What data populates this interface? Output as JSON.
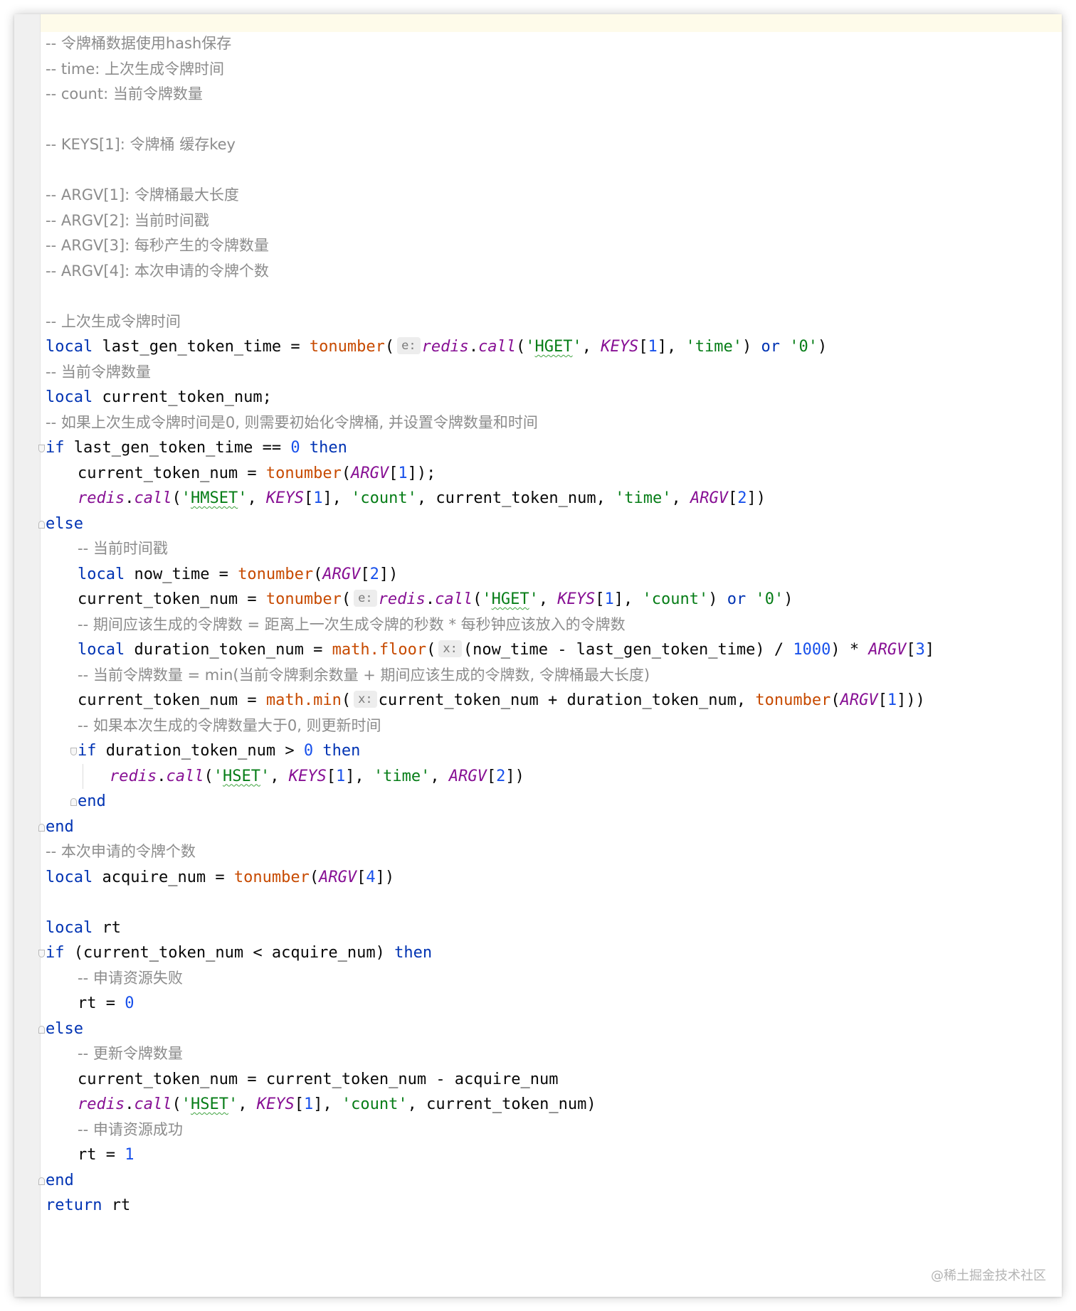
{
  "editor": {
    "lines": [
      {
        "indent": 0,
        "fold": "",
        "tokens": [
          {
            "t": "cm",
            "v": "-- 令牌桶数据使用hash保存"
          }
        ]
      },
      {
        "indent": 0,
        "fold": "",
        "tokens": [
          {
            "t": "cm",
            "v": "-- time: 上次生成令牌时间"
          }
        ]
      },
      {
        "indent": 0,
        "fold": "",
        "tokens": [
          {
            "t": "cm",
            "v": "-- count: 当前令牌数量"
          }
        ]
      },
      {
        "indent": 0,
        "fold": "",
        "tokens": []
      },
      {
        "indent": 0,
        "fold": "",
        "tokens": [
          {
            "t": "cm",
            "v": "-- KEYS[1]: 令牌桶 缓存key"
          }
        ]
      },
      {
        "indent": 0,
        "fold": "",
        "tokens": []
      },
      {
        "indent": 0,
        "fold": "",
        "tokens": [
          {
            "t": "cm",
            "v": "-- ARGV[1]: 令牌桶最大长度"
          }
        ]
      },
      {
        "indent": 0,
        "fold": "",
        "tokens": [
          {
            "t": "cm",
            "v": "-- ARGV[2]: 当前时间戳"
          }
        ]
      },
      {
        "indent": 0,
        "fold": "",
        "tokens": [
          {
            "t": "cm",
            "v": "-- ARGV[3]: 每秒产生的令牌数量"
          }
        ]
      },
      {
        "indent": 0,
        "fold": "",
        "tokens": [
          {
            "t": "cm",
            "v": "-- ARGV[4]: 本次申请的令牌个数"
          }
        ]
      },
      {
        "indent": 0,
        "fold": "",
        "tokens": []
      },
      {
        "indent": 0,
        "fold": "",
        "tokens": [
          {
            "t": "cm",
            "v": "-- 上次生成令牌时间"
          }
        ]
      },
      {
        "indent": 0,
        "fold": "",
        "tokens": [
          {
            "t": "kw",
            "v": "local"
          },
          {
            "t": "",
            "v": " last_gen_token_time = "
          },
          {
            "t": "fn",
            "v": "tonumber"
          },
          {
            "t": "",
            "v": "("
          },
          {
            "t": "hint",
            "v": "e:"
          },
          {
            "t": "gv",
            "v": "redis"
          },
          {
            "t": "",
            "v": "."
          },
          {
            "t": "gv",
            "v": "call"
          },
          {
            "t": "",
            "v": "("
          },
          {
            "t": "str",
            "v": "'"
          },
          {
            "t": "str spell",
            "v": "HGET"
          },
          {
            "t": "str",
            "v": "'"
          },
          {
            "t": "",
            "v": ", "
          },
          {
            "t": "gv",
            "v": "KEYS"
          },
          {
            "t": "",
            "v": "["
          },
          {
            "t": "num",
            "v": "1"
          },
          {
            "t": "",
            "v": "], "
          },
          {
            "t": "str",
            "v": "'time'"
          },
          {
            "t": "",
            "v": ") "
          },
          {
            "t": "kw",
            "v": "or"
          },
          {
            "t": "",
            "v": " "
          },
          {
            "t": "str",
            "v": "'0'"
          },
          {
            "t": "",
            "v": ")"
          }
        ]
      },
      {
        "indent": 0,
        "fold": "",
        "tokens": [
          {
            "t": "cm",
            "v": "-- 当前令牌数量"
          }
        ]
      },
      {
        "indent": 0,
        "fold": "",
        "tokens": [
          {
            "t": "kw",
            "v": "local"
          },
          {
            "t": "",
            "v": " current_token_num;"
          }
        ]
      },
      {
        "indent": 0,
        "fold": "",
        "tokens": [
          {
            "t": "cm",
            "v": "-- 如果上次生成令牌时间是0, 则需要初始化令牌桶, 并设置令牌数量和时间"
          }
        ]
      },
      {
        "indent": 0,
        "fold": "start",
        "tokens": [
          {
            "t": "kw",
            "v": "if"
          },
          {
            "t": "",
            "v": " last_gen_token_time == "
          },
          {
            "t": "num",
            "v": "0"
          },
          {
            "t": "",
            "v": " "
          },
          {
            "t": "kw",
            "v": "then"
          }
        ]
      },
      {
        "indent": 1,
        "fold": "",
        "tokens": [
          {
            "t": "",
            "v": "current_token_num = "
          },
          {
            "t": "fn",
            "v": "tonumber"
          },
          {
            "t": "",
            "v": "("
          },
          {
            "t": "gv",
            "v": "ARGV"
          },
          {
            "t": "",
            "v": "["
          },
          {
            "t": "num",
            "v": "1"
          },
          {
            "t": "",
            "v": "]);"
          }
        ]
      },
      {
        "indent": 1,
        "fold": "",
        "tokens": [
          {
            "t": "gv",
            "v": "redis"
          },
          {
            "t": "",
            "v": "."
          },
          {
            "t": "gv",
            "v": "call"
          },
          {
            "t": "",
            "v": "("
          },
          {
            "t": "str",
            "v": "'"
          },
          {
            "t": "str spell",
            "v": "HMSET"
          },
          {
            "t": "str",
            "v": "'"
          },
          {
            "t": "",
            "v": ", "
          },
          {
            "t": "gv",
            "v": "KEYS"
          },
          {
            "t": "",
            "v": "["
          },
          {
            "t": "num",
            "v": "1"
          },
          {
            "t": "",
            "v": "], "
          },
          {
            "t": "str",
            "v": "'count'"
          },
          {
            "t": "",
            "v": ", current_token_num, "
          },
          {
            "t": "str",
            "v": "'time'"
          },
          {
            "t": "",
            "v": ", "
          },
          {
            "t": "gv",
            "v": "ARGV"
          },
          {
            "t": "",
            "v": "["
          },
          {
            "t": "num",
            "v": "2"
          },
          {
            "t": "",
            "v": "])"
          }
        ]
      },
      {
        "indent": 0,
        "fold": "end",
        "tokens": [
          {
            "t": "kw",
            "v": "else"
          }
        ]
      },
      {
        "indent": 1,
        "fold": "",
        "tokens": [
          {
            "t": "cm",
            "v": "-- 当前时间戳"
          }
        ]
      },
      {
        "indent": 1,
        "fold": "",
        "tokens": [
          {
            "t": "kw",
            "v": "local"
          },
          {
            "t": "",
            "v": " now_time = "
          },
          {
            "t": "fn",
            "v": "tonumber"
          },
          {
            "t": "",
            "v": "("
          },
          {
            "t": "gv",
            "v": "ARGV"
          },
          {
            "t": "",
            "v": "["
          },
          {
            "t": "num",
            "v": "2"
          },
          {
            "t": "",
            "v": "])"
          }
        ]
      },
      {
        "indent": 1,
        "fold": "",
        "tokens": [
          {
            "t": "",
            "v": "current_token_num = "
          },
          {
            "t": "fn",
            "v": "tonumber"
          },
          {
            "t": "",
            "v": "("
          },
          {
            "t": "hint",
            "v": "e:"
          },
          {
            "t": "gv",
            "v": "redis"
          },
          {
            "t": "",
            "v": "."
          },
          {
            "t": "gv",
            "v": "call"
          },
          {
            "t": "",
            "v": "("
          },
          {
            "t": "str",
            "v": "'"
          },
          {
            "t": "str spell",
            "v": "HGET"
          },
          {
            "t": "str",
            "v": "'"
          },
          {
            "t": "",
            "v": ", "
          },
          {
            "t": "gv",
            "v": "KEYS"
          },
          {
            "t": "",
            "v": "["
          },
          {
            "t": "num",
            "v": "1"
          },
          {
            "t": "",
            "v": "], "
          },
          {
            "t": "str",
            "v": "'count'"
          },
          {
            "t": "",
            "v": ") "
          },
          {
            "t": "kw",
            "v": "or"
          },
          {
            "t": "",
            "v": " "
          },
          {
            "t": "str",
            "v": "'0'"
          },
          {
            "t": "",
            "v": ")"
          }
        ]
      },
      {
        "indent": 1,
        "fold": "",
        "tokens": [
          {
            "t": "cm",
            "v": "-- 期间应该生成的令牌数 = 距离上一次生成令牌的秒数 * 每秒钟应该放入的令牌数"
          }
        ]
      },
      {
        "indent": 1,
        "fold": "",
        "tokens": [
          {
            "t": "kw",
            "v": "local"
          },
          {
            "t": "",
            "v": " duration_token_num = "
          },
          {
            "t": "fn",
            "v": "math.floor"
          },
          {
            "t": "",
            "v": "("
          },
          {
            "t": "hint",
            "v": "x:"
          },
          {
            "t": "",
            "v": "(now_time - last_gen_token_time) / "
          },
          {
            "t": "num",
            "v": "1000"
          },
          {
            "t": "",
            "v": ") * "
          },
          {
            "t": "gv",
            "v": "ARGV"
          },
          {
            "t": "",
            "v": "["
          },
          {
            "t": "num",
            "v": "3"
          },
          {
            "t": "",
            "v": "]"
          }
        ]
      },
      {
        "indent": 1,
        "fold": "",
        "tokens": [
          {
            "t": "cm",
            "v": "-- 当前令牌数量 = min(当前令牌剩余数量 + 期间应该生成的令牌数, 令牌桶最大长度)"
          }
        ]
      },
      {
        "indent": 1,
        "fold": "",
        "tokens": [
          {
            "t": "",
            "v": "current_token_num = "
          },
          {
            "t": "fn",
            "v": "math.min"
          },
          {
            "t": "",
            "v": "("
          },
          {
            "t": "hint",
            "v": "x:"
          },
          {
            "t": "",
            "v": "current_token_num + duration_token_num, "
          },
          {
            "t": "fn",
            "v": "tonumber"
          },
          {
            "t": "",
            "v": "("
          },
          {
            "t": "gv",
            "v": "ARGV"
          },
          {
            "t": "",
            "v": "["
          },
          {
            "t": "num",
            "v": "1"
          },
          {
            "t": "",
            "v": "]))"
          }
        ]
      },
      {
        "indent": 1,
        "fold": "",
        "tokens": [
          {
            "t": "cm",
            "v": "-- 如果本次生成的令牌数量大于0, 则更新时间"
          }
        ]
      },
      {
        "indent": 1,
        "fold": "start",
        "tokens": [
          {
            "t": "kw",
            "v": "if"
          },
          {
            "t": "",
            "v": " duration_token_num > "
          },
          {
            "t": "num",
            "v": "0"
          },
          {
            "t": "",
            "v": " "
          },
          {
            "t": "kw",
            "v": "then"
          }
        ]
      },
      {
        "indent": 2,
        "fold": "",
        "guide": true,
        "tokens": [
          {
            "t": "gv",
            "v": "redis"
          },
          {
            "t": "",
            "v": "."
          },
          {
            "t": "gv",
            "v": "call"
          },
          {
            "t": "",
            "v": "("
          },
          {
            "t": "str",
            "v": "'"
          },
          {
            "t": "str spell",
            "v": "HSET"
          },
          {
            "t": "str",
            "v": "'"
          },
          {
            "t": "",
            "v": ", "
          },
          {
            "t": "gv",
            "v": "KEYS"
          },
          {
            "t": "",
            "v": "["
          },
          {
            "t": "num",
            "v": "1"
          },
          {
            "t": "",
            "v": "], "
          },
          {
            "t": "str",
            "v": "'time'"
          },
          {
            "t": "",
            "v": ", "
          },
          {
            "t": "gv",
            "v": "ARGV"
          },
          {
            "t": "",
            "v": "["
          },
          {
            "t": "num",
            "v": "2"
          },
          {
            "t": "",
            "v": "])"
          }
        ]
      },
      {
        "indent": 1,
        "fold": "end",
        "tokens": [
          {
            "t": "kw",
            "v": "end"
          }
        ]
      },
      {
        "indent": 0,
        "fold": "end",
        "tokens": [
          {
            "t": "kw",
            "v": "end"
          }
        ]
      },
      {
        "indent": 0,
        "fold": "",
        "tokens": [
          {
            "t": "cm",
            "v": "-- 本次申请的令牌个数"
          }
        ]
      },
      {
        "indent": 0,
        "fold": "",
        "tokens": [
          {
            "t": "kw",
            "v": "local"
          },
          {
            "t": "",
            "v": " acquire_num = "
          },
          {
            "t": "fn",
            "v": "tonumber"
          },
          {
            "t": "",
            "v": "("
          },
          {
            "t": "gv",
            "v": "ARGV"
          },
          {
            "t": "",
            "v": "["
          },
          {
            "t": "num",
            "v": "4"
          },
          {
            "t": "",
            "v": "])"
          }
        ]
      },
      {
        "indent": 0,
        "fold": "",
        "tokens": []
      },
      {
        "indent": 0,
        "fold": "",
        "tokens": [
          {
            "t": "kw",
            "v": "local"
          },
          {
            "t": "",
            "v": " rt"
          }
        ]
      },
      {
        "indent": 0,
        "fold": "start",
        "tokens": [
          {
            "t": "kw",
            "v": "if"
          },
          {
            "t": "",
            "v": " (current_token_num < acquire_num) "
          },
          {
            "t": "kw",
            "v": "then"
          }
        ]
      },
      {
        "indent": 1,
        "fold": "",
        "tokens": [
          {
            "t": "cm",
            "v": "-- 申请资源失败"
          }
        ]
      },
      {
        "indent": 1,
        "fold": "",
        "tokens": [
          {
            "t": "",
            "v": "rt = "
          },
          {
            "t": "num",
            "v": "0"
          }
        ]
      },
      {
        "indent": 0,
        "fold": "end",
        "tokens": [
          {
            "t": "kw",
            "v": "else"
          }
        ]
      },
      {
        "indent": 1,
        "fold": "",
        "tokens": [
          {
            "t": "cm",
            "v": "-- 更新令牌数量"
          }
        ]
      },
      {
        "indent": 1,
        "fold": "",
        "tokens": [
          {
            "t": "",
            "v": "current_token_num = current_token_num - acquire_num"
          }
        ]
      },
      {
        "indent": 1,
        "fold": "",
        "tokens": [
          {
            "t": "gv",
            "v": "redis"
          },
          {
            "t": "",
            "v": "."
          },
          {
            "t": "gv",
            "v": "call"
          },
          {
            "t": "",
            "v": "("
          },
          {
            "t": "str",
            "v": "'"
          },
          {
            "t": "str spell",
            "v": "HSET"
          },
          {
            "t": "str",
            "v": "'"
          },
          {
            "t": "",
            "v": ", "
          },
          {
            "t": "gv",
            "v": "KEYS"
          },
          {
            "t": "",
            "v": "["
          },
          {
            "t": "num",
            "v": "1"
          },
          {
            "t": "",
            "v": "], "
          },
          {
            "t": "str",
            "v": "'count'"
          },
          {
            "t": "",
            "v": ", current_token_num)"
          }
        ]
      },
      {
        "indent": 1,
        "fold": "",
        "tokens": [
          {
            "t": "cm",
            "v": "-- 申请资源成功"
          }
        ]
      },
      {
        "indent": 1,
        "fold": "",
        "tokens": [
          {
            "t": "",
            "v": "rt = "
          },
          {
            "t": "num",
            "v": "1"
          }
        ]
      },
      {
        "indent": 0,
        "fold": "end",
        "tokens": [
          {
            "t": "kw",
            "v": "end"
          }
        ]
      },
      {
        "indent": 0,
        "fold": "",
        "tokens": [
          {
            "t": "kw",
            "v": "return"
          },
          {
            "t": "",
            "v": " rt"
          }
        ]
      }
    ]
  },
  "watermark": "@稀土掘金技术社区",
  "colors": {
    "keyword": "#0033b3",
    "function": "#c74a00",
    "global": "#871094",
    "string": "#067d17",
    "number": "#1750eb",
    "comment": "#8c8c8c"
  }
}
